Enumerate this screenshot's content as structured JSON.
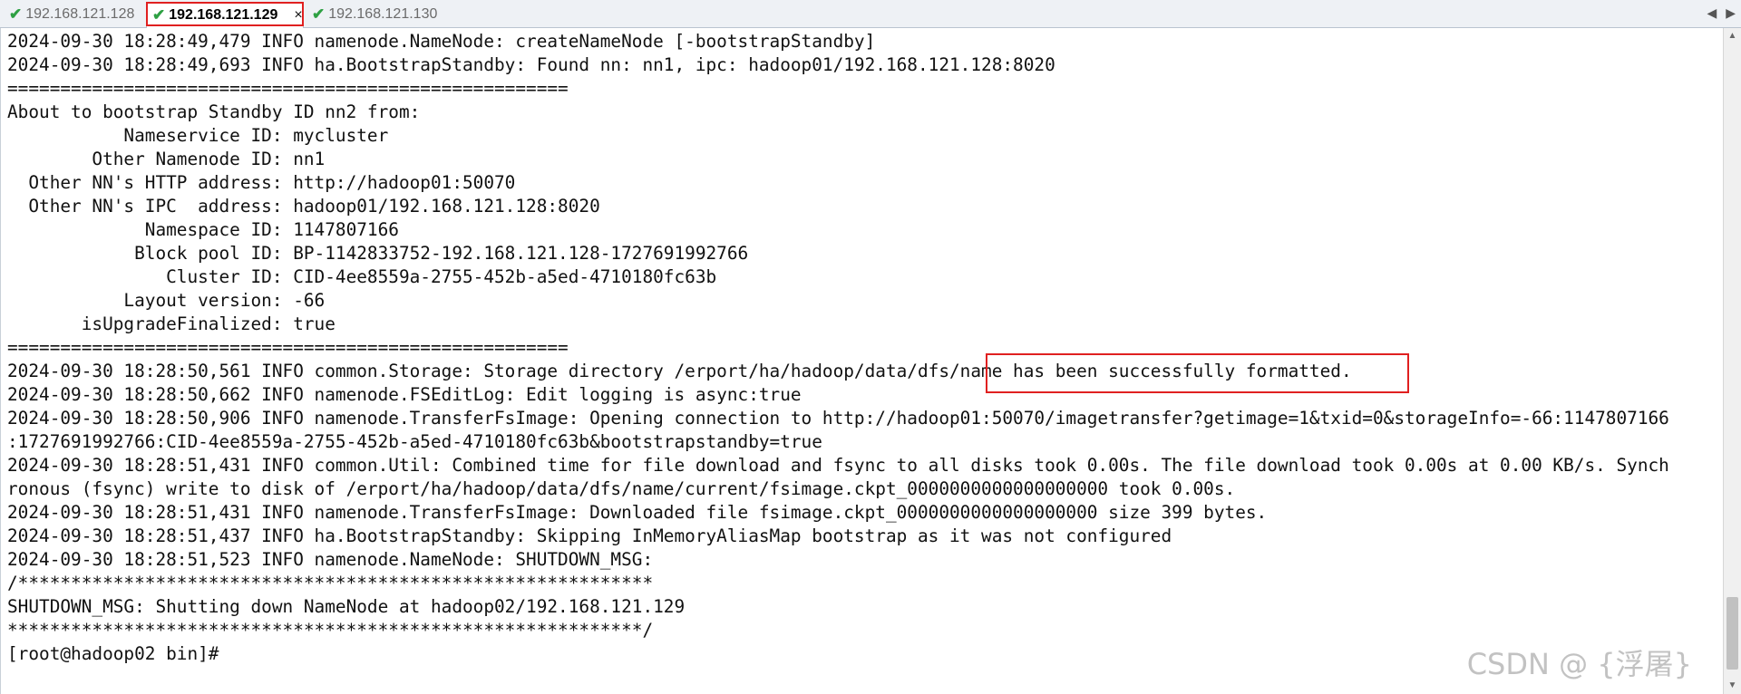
{
  "tabs": [
    {
      "label": "192.168.121.128",
      "icon": "check-icon",
      "active": false
    },
    {
      "label": "192.168.121.129",
      "icon": "check-icon",
      "active": true,
      "close": "×"
    },
    {
      "label": "192.168.121.130",
      "icon": "check-icon",
      "active": false
    }
  ],
  "tab_scroll": {
    "left": "◀",
    "right": "▶"
  },
  "terminal": {
    "lines": [
      "2024-09-30 18:28:49,479 INFO namenode.NameNode: createNameNode [-bootstrapStandby]",
      "2024-09-30 18:28:49,693 INFO ha.BootstrapStandby: Found nn: nn1, ipc: hadoop01/192.168.121.128:8020",
      "=====================================================",
      "About to bootstrap Standby ID nn2 from:",
      "           Nameservice ID: mycluster",
      "        Other Namenode ID: nn1",
      "  Other NN's HTTP address: http://hadoop01:50070",
      "  Other NN's IPC  address: hadoop01/192.168.121.128:8020",
      "             Namespace ID: 1147807166",
      "            Block pool ID: BP-1142833752-192.168.121.128-1727691992766",
      "               Cluster ID: CID-4ee8559a-2755-452b-a5ed-4710180fc63b",
      "           Layout version: -66",
      "       isUpgradeFinalized: true",
      "=====================================================",
      "2024-09-30 18:28:50,561 INFO common.Storage: Storage directory /erport/ha/hadoop/data/dfs/name has been successfully formatted.",
      "2024-09-30 18:28:50,662 INFO namenode.FSEditLog: Edit logging is async:true",
      "2024-09-30 18:28:50,906 INFO namenode.TransferFsImage: Opening connection to http://hadoop01:50070/imagetransfer?getimage=1&txid=0&storageInfo=-66:1147807166",
      ":1727691992766:CID-4ee8559a-2755-452b-a5ed-4710180fc63b&bootstrapstandby=true",
      "2024-09-30 18:28:51,431 INFO common.Util: Combined time for file download and fsync to all disks took 0.00s. The file download took 0.00s at 0.00 KB/s. Synch",
      "ronous (fsync) write to disk of /erport/ha/hadoop/data/dfs/name/current/fsimage.ckpt_0000000000000000000 took 0.00s.",
      "2024-09-30 18:28:51,431 INFO namenode.TransferFsImage: Downloaded file fsimage.ckpt_0000000000000000000 size 399 bytes.",
      "2024-09-30 18:28:51,437 INFO ha.BootstrapStandby: Skipping InMemoryAliasMap bootstrap as it was not configured",
      "2024-09-30 18:28:51,523 INFO namenode.NameNode: SHUTDOWN_MSG:",
      "/************************************************************",
      "SHUTDOWN_MSG: Shutting down NameNode at hadoop02/192.168.121.129",
      "************************************************************/",
      "[root@hadoop02 bin]#"
    ]
  },
  "watermark": "CSDN @ {浮屠}"
}
